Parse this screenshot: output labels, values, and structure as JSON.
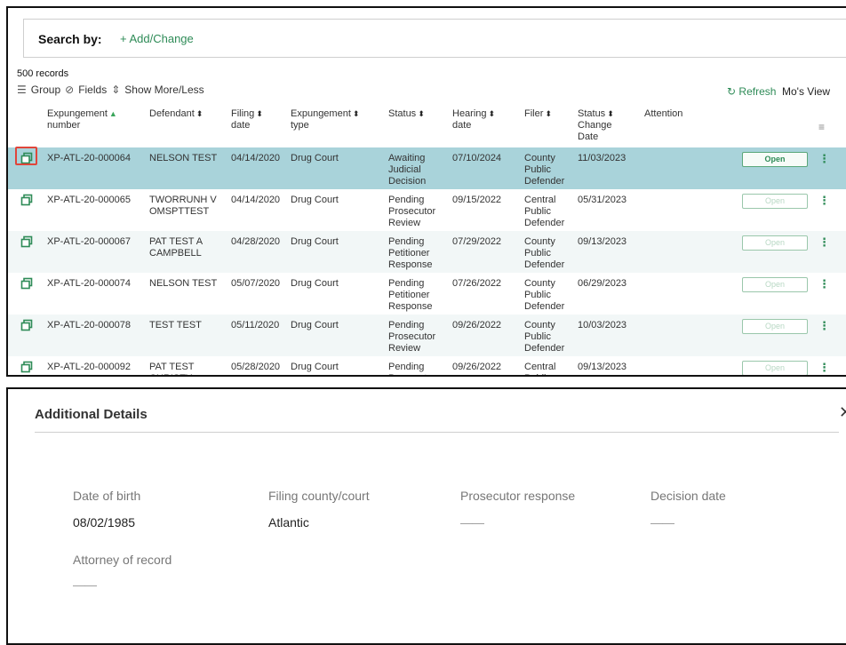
{
  "search": {
    "label": "Search by:",
    "add_change": "+ Add/Change"
  },
  "records_count": "500 records",
  "toolbar": {
    "group": "Group",
    "fields": "Fields",
    "show_more": "Show More/Less",
    "refresh": "Refresh",
    "view": "Mo's View"
  },
  "columns": {
    "expungement_number": [
      "Expungement",
      "number"
    ],
    "defendant": [
      "Defendant"
    ],
    "filing_date": [
      "Filing",
      "date"
    ],
    "expungement_type": [
      "Expungement",
      "type"
    ],
    "status": [
      "Status"
    ],
    "hearing_date": [
      "Hearing",
      "date"
    ],
    "filer": [
      "Filer"
    ],
    "status_change_date": [
      "Status",
      "Change",
      "Date"
    ],
    "attention": [
      "Attention"
    ]
  },
  "rows": [
    {
      "number": "XP-ATL-20-000064",
      "defendant": [
        "NELSON TEST"
      ],
      "filing_date": "04/14/2020",
      "type": "Drug Court",
      "status": [
        "Awaiting",
        "Judicial",
        "Decision"
      ],
      "hearing_date": "07/10/2024",
      "filer": [
        "County",
        "Public",
        "Defender"
      ],
      "status_change_date": "11/03/2023",
      "open": "Open"
    },
    {
      "number": "XP-ATL-20-000065",
      "defendant": [
        "TWORRUNH V",
        "OMSPTTEST"
      ],
      "filing_date": "04/14/2020",
      "type": "Drug Court",
      "status": [
        "Pending",
        "Prosecutor",
        "Review"
      ],
      "hearing_date": "09/15/2022",
      "filer": [
        "Central",
        "Public",
        "Defender"
      ],
      "status_change_date": "05/31/2023",
      "open": "Open"
    },
    {
      "number": "XP-ATL-20-000067",
      "defendant": [
        "PAT TEST A",
        "CAMPBELL"
      ],
      "filing_date": "04/28/2020",
      "type": "Drug Court",
      "status": [
        "Pending",
        "Petitioner",
        "Response"
      ],
      "hearing_date": "07/29/2022",
      "filer": [
        "County",
        "Public",
        "Defender"
      ],
      "status_change_date": "09/13/2023",
      "open": "Open"
    },
    {
      "number": "XP-ATL-20-000074",
      "defendant": [
        "NELSON TEST"
      ],
      "filing_date": "05/07/2020",
      "type": "Drug Court",
      "status": [
        "Pending",
        "Petitioner",
        "Response"
      ],
      "hearing_date": "07/26/2022",
      "filer": [
        "County",
        "Public",
        "Defender"
      ],
      "status_change_date": "06/29/2023",
      "open": "Open"
    },
    {
      "number": "XP-ATL-20-000078",
      "defendant": [
        "TEST TEST"
      ],
      "filing_date": "05/11/2020",
      "type": "Drug Court",
      "status": [
        "Pending",
        "Prosecutor",
        "Review"
      ],
      "hearing_date": "09/26/2022",
      "filer": [
        "County",
        "Public",
        "Defender"
      ],
      "status_change_date": "10/03/2023",
      "open": "Open"
    },
    {
      "number": "XP-ATL-20-000092",
      "defendant": [
        "PAT TEST",
        "CHRISTY"
      ],
      "filing_date": "05/28/2020",
      "type": "Drug Court",
      "status": [
        "Pending",
        "Prosecutor"
      ],
      "hearing_date": "09/26/2022",
      "filer": [
        "Central",
        "Public"
      ],
      "status_change_date": "09/13/2023",
      "open": "Open"
    }
  ],
  "details": {
    "title": "Additional Details",
    "dob_label": "Date of birth",
    "dob_value": "08/02/1985",
    "county_label": "Filing county/court",
    "county_value": "Atlantic",
    "prosecutor_label": "Prosecutor response",
    "prosecutor_value": "——",
    "decision_label": "Decision date",
    "decision_value": "——",
    "attorney_label": "Attorney of record",
    "attorney_value": "——"
  },
  "colors": {
    "accent": "#2e8b57",
    "selected_row": "#a9d3da",
    "highlight": "#e0453a"
  }
}
